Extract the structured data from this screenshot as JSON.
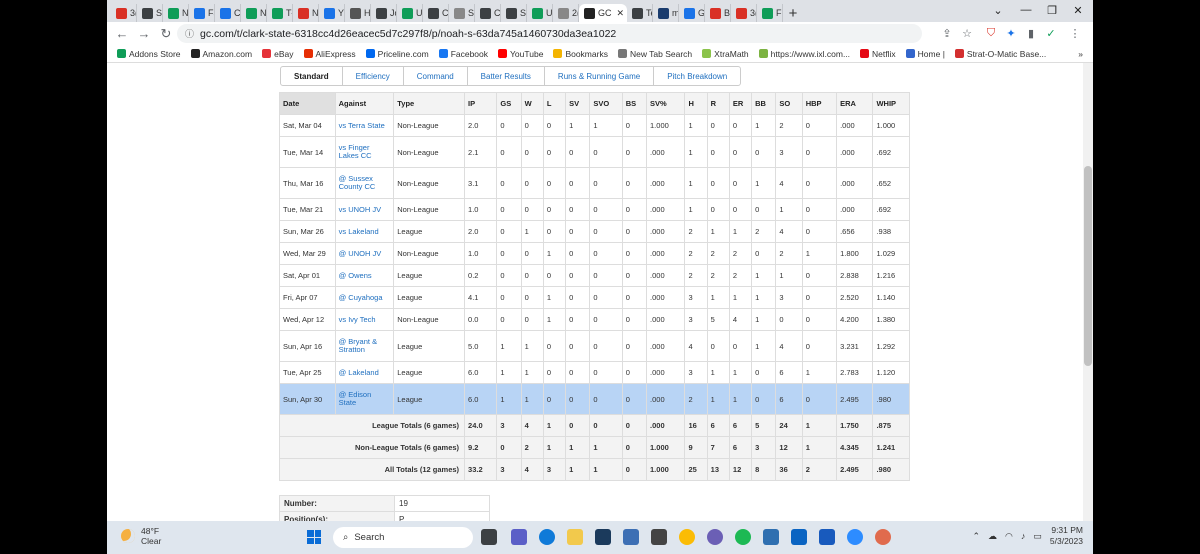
{
  "browser": {
    "tabs": [
      {
        "label": "3(",
        "color": "#d93025"
      },
      {
        "label": "St",
        "color": "#3c4043"
      },
      {
        "label": "N",
        "color": "#0f9d58"
      },
      {
        "label": "Fa",
        "color": "#1a73e8"
      },
      {
        "label": "Cc",
        "color": "#1a73e8"
      },
      {
        "label": "N",
        "color": "#0f9d58"
      },
      {
        "label": "Tł",
        "color": "#0f9d58"
      },
      {
        "label": "N",
        "color": "#d93025"
      },
      {
        "label": "Yc",
        "color": "#1a73e8"
      },
      {
        "label": "H",
        "color": "#555555"
      },
      {
        "label": "Jc",
        "color": "#3c4043"
      },
      {
        "label": "U",
        "color": "#0f9d58"
      },
      {
        "label": "Cl",
        "color": "#3c4043"
      },
      {
        "label": "Sr",
        "color": "#888888"
      },
      {
        "label": "Cl",
        "color": "#3c4043"
      },
      {
        "label": "St",
        "color": "#3c4043"
      },
      {
        "label": "U",
        "color": "#0f9d58"
      },
      {
        "label": "2(",
        "color": "#888888"
      }
    ],
    "active_tab": {
      "label": "GC",
      "color": "#222222"
    },
    "tabs_after": [
      {
        "label": "Te",
        "color": "#3c4043"
      },
      {
        "label": "m",
        "color": "#1a3c6e"
      },
      {
        "label": "G",
        "color": "#1a73e8"
      },
      {
        "label": "Bi",
        "color": "#d93025"
      },
      {
        "label": "3(",
        "color": "#d93025"
      },
      {
        "label": "Fi",
        "color": "#0f9d58"
      }
    ],
    "new_tab": "+",
    "url": "gc.com/t/clark-state-6318cc4d26eacec5d7c297f8/p/noah-s-63da745a1460730da3ea1022",
    "bookmarks": [
      {
        "label": "Addons Store",
        "color": "#0f9d58"
      },
      {
        "label": "Amazon.com",
        "color": "#222222"
      },
      {
        "label": "eBay",
        "color": "#e53238"
      },
      {
        "label": "AliExpress",
        "color": "#e62e04"
      },
      {
        "label": "Priceline.com",
        "color": "#0068ef"
      },
      {
        "label": "Facebook",
        "color": "#1877f2"
      },
      {
        "label": "YouTube",
        "color": "#ff0000"
      },
      {
        "label": "Bookmarks",
        "color": "#f4b400"
      },
      {
        "label": "New Tab Search",
        "color": "#777777"
      },
      {
        "label": "XtraMath",
        "color": "#8bc34a"
      },
      {
        "label": "https://www.ixl.com...",
        "color": "#7cb342"
      },
      {
        "label": "Netflix",
        "color": "#e50914"
      },
      {
        "label": "Home |",
        "color": "#3366cc"
      },
      {
        "label": "Strat-O-Matic Base...",
        "color": "#d32f2f"
      }
    ]
  },
  "subtabs": [
    "Standard",
    "Efficiency",
    "Command",
    "Batter Results",
    "Runs & Running Game",
    "Pitch Breakdown"
  ],
  "stats": {
    "headers": [
      "Date",
      "Against",
      "Type",
      "IP",
      "GS",
      "W",
      "L",
      "SV",
      "SVO",
      "BS",
      "SV%",
      "H",
      "R",
      "ER",
      "BB",
      "SO",
      "HBP",
      "ERA",
      "WHIP"
    ],
    "rows": [
      {
        "date": "Sat, Mar 04",
        "against": "vs Terra State",
        "type": "Non-League",
        "ip": "2.0",
        "gs": "0",
        "w": "0",
        "l": "0",
        "sv": "1",
        "svo": "1",
        "bs": "0",
        "svp": "1.000",
        "h": "1",
        "r": "0",
        "er": "0",
        "bb": "1",
        "so": "2",
        "hbp": "0",
        "era": ".000",
        "whip": "1.000"
      },
      {
        "date": "Tue, Mar 14",
        "against": "vs Finger Lakes CC",
        "type": "Non-League",
        "ip": "2.1",
        "gs": "0",
        "w": "0",
        "l": "0",
        "sv": "0",
        "svo": "0",
        "bs": "0",
        "svp": ".000",
        "h": "1",
        "r": "0",
        "er": "0",
        "bb": "0",
        "so": "3",
        "hbp": "0",
        "era": ".000",
        "whip": ".692"
      },
      {
        "date": "Thu, Mar 16",
        "against": "@ Sussex County CC",
        "type": "Non-League",
        "ip": "3.1",
        "gs": "0",
        "w": "0",
        "l": "0",
        "sv": "0",
        "svo": "0",
        "bs": "0",
        "svp": ".000",
        "h": "1",
        "r": "0",
        "er": "0",
        "bb": "1",
        "so": "4",
        "hbp": "0",
        "era": ".000",
        "whip": ".652"
      },
      {
        "date": "Tue, Mar 21",
        "against": "vs UNOH JV",
        "type": "Non-League",
        "ip": "1.0",
        "gs": "0",
        "w": "0",
        "l": "0",
        "sv": "0",
        "svo": "0",
        "bs": "0",
        "svp": ".000",
        "h": "1",
        "r": "0",
        "er": "0",
        "bb": "0",
        "so": "1",
        "hbp": "0",
        "era": ".000",
        "whip": ".692"
      },
      {
        "date": "Sun, Mar 26",
        "against": "vs Lakeland",
        "type": "League",
        "ip": "2.0",
        "gs": "0",
        "w": "1",
        "l": "0",
        "sv": "0",
        "svo": "0",
        "bs": "0",
        "svp": ".000",
        "h": "2",
        "r": "1",
        "er": "1",
        "bb": "2",
        "so": "4",
        "hbp": "0",
        "era": ".656",
        "whip": ".938"
      },
      {
        "date": "Wed, Mar 29",
        "against": "@ UNOH JV",
        "type": "Non-League",
        "ip": "1.0",
        "gs": "0",
        "w": "0",
        "l": "1",
        "sv": "0",
        "svo": "0",
        "bs": "0",
        "svp": ".000",
        "h": "2",
        "r": "2",
        "er": "2",
        "bb": "0",
        "so": "2",
        "hbp": "1",
        "era": "1.800",
        "whip": "1.029"
      },
      {
        "date": "Sat, Apr 01",
        "against": "@ Owens",
        "type": "League",
        "ip": "0.2",
        "gs": "0",
        "w": "0",
        "l": "0",
        "sv": "0",
        "svo": "0",
        "bs": "0",
        "svp": ".000",
        "h": "2",
        "r": "2",
        "er": "2",
        "bb": "1",
        "so": "1",
        "hbp": "0",
        "era": "2.838",
        "whip": "1.216"
      },
      {
        "date": "Fri, Apr 07",
        "against": "@ Cuyahoga",
        "type": "League",
        "ip": "4.1",
        "gs": "0",
        "w": "0",
        "l": "1",
        "sv": "0",
        "svo": "0",
        "bs": "0",
        "svp": ".000",
        "h": "3",
        "r": "1",
        "er": "1",
        "bb": "1",
        "so": "3",
        "hbp": "0",
        "era": "2.520",
        "whip": "1.140"
      },
      {
        "date": "Wed, Apr 12",
        "against": "vs Ivy Tech",
        "type": "Non-League",
        "ip": "0.0",
        "gs": "0",
        "w": "0",
        "l": "1",
        "sv": "0",
        "svo": "0",
        "bs": "0",
        "svp": ".000",
        "h": "3",
        "r": "5",
        "er": "4",
        "bb": "1",
        "so": "0",
        "hbp": "0",
        "era": "4.200",
        "whip": "1.380"
      },
      {
        "date": "Sun, Apr 16",
        "against": "@ Bryant & Stratton",
        "type": "League",
        "ip": "5.0",
        "gs": "1",
        "w": "1",
        "l": "0",
        "sv": "0",
        "svo": "0",
        "bs": "0",
        "svp": ".000",
        "h": "4",
        "r": "0",
        "er": "0",
        "bb": "1",
        "so": "4",
        "hbp": "0",
        "era": "3.231",
        "whip": "1.292"
      },
      {
        "date": "Tue, Apr 25",
        "against": "@ Lakeland",
        "type": "League",
        "ip": "6.0",
        "gs": "1",
        "w": "1",
        "l": "0",
        "sv": "0",
        "svo": "0",
        "bs": "0",
        "svp": ".000",
        "h": "3",
        "r": "1",
        "er": "1",
        "bb": "0",
        "so": "6",
        "hbp": "1",
        "era": "2.783",
        "whip": "1.120"
      },
      {
        "date": "Sun, Apr 30",
        "against": "@ Edison State",
        "type": "League",
        "ip": "6.0",
        "gs": "1",
        "w": "1",
        "l": "0",
        "sv": "0",
        "svo": "0",
        "bs": "0",
        "svp": ".000",
        "h": "2",
        "r": "1",
        "er": "1",
        "bb": "0",
        "so": "6",
        "hbp": "0",
        "era": "2.495",
        "whip": ".980"
      }
    ],
    "totals": [
      {
        "label": "League Totals (6 games)",
        "ip": "24.0",
        "gs": "3",
        "w": "4",
        "l": "1",
        "sv": "0",
        "svo": "0",
        "bs": "0",
        "svp": ".000",
        "h": "16",
        "r": "6",
        "er": "6",
        "bb": "5",
        "so": "24",
        "hbp": "1",
        "era": "1.750",
        "whip": ".875"
      },
      {
        "label": "Non-League Totals (6 games)",
        "ip": "9.2",
        "gs": "0",
        "w": "2",
        "l": "1",
        "sv": "1",
        "svo": "1",
        "bs": "0",
        "svp": "1.000",
        "h": "9",
        "r": "7",
        "er": "6",
        "bb": "3",
        "so": "12",
        "hbp": "1",
        "era": "4.345",
        "whip": "1.241"
      },
      {
        "label": "All Totals (12 games)",
        "ip": "33.2",
        "gs": "3",
        "w": "4",
        "l": "3",
        "sv": "1",
        "svo": "1",
        "bs": "0",
        "svp": "1.000",
        "h": "25",
        "r": "13",
        "er": "12",
        "bb": "8",
        "so": "36",
        "hbp": "2",
        "era": "2.495",
        "whip": ".980"
      }
    ]
  },
  "player_info": [
    {
      "label": "Number:",
      "value": "19"
    },
    {
      "label": "Position(s):",
      "value": "P"
    }
  ],
  "taskbar": {
    "weather_temp": "48°F",
    "weather_desc": "Clear",
    "search_placeholder": "Search",
    "time": "9:31 PM",
    "date": "5/3/2023"
  }
}
